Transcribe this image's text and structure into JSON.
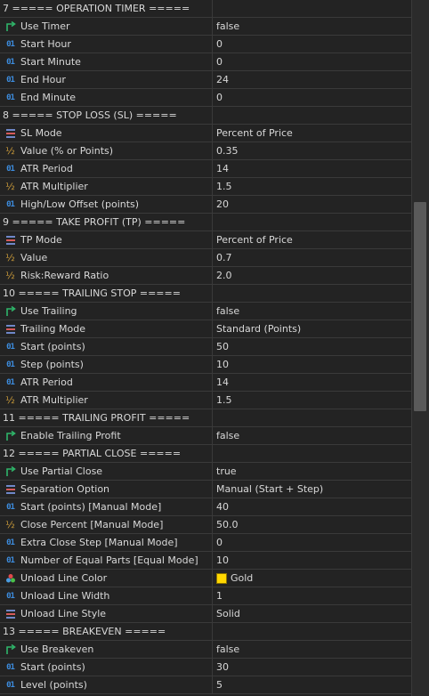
{
  "rows": [
    {
      "kind": "section",
      "name": "7 ===== OPERATION TIMER =====",
      "value": ""
    },
    {
      "kind": "bool",
      "name": "Use Timer",
      "value": "false"
    },
    {
      "kind": "int",
      "name": "Start Hour",
      "value": "0"
    },
    {
      "kind": "int",
      "name": "Start Minute",
      "value": "0"
    },
    {
      "kind": "int",
      "name": "End Hour",
      "value": "24"
    },
    {
      "kind": "int",
      "name": "End Minute",
      "value": "0"
    },
    {
      "kind": "section",
      "name": "8 ===== STOP LOSS (SL) =====",
      "value": ""
    },
    {
      "kind": "enum",
      "name": "SL Mode",
      "value": "Percent of Price"
    },
    {
      "kind": "frac",
      "name": "Value (% or Points)",
      "value": "0.35"
    },
    {
      "kind": "int",
      "name": "ATR Period",
      "value": "14"
    },
    {
      "kind": "frac",
      "name": "ATR Multiplier",
      "value": "1.5"
    },
    {
      "kind": "int",
      "name": "High/Low Offset (points)",
      "value": "20"
    },
    {
      "kind": "section",
      "name": "9 ===== TAKE PROFIT (TP) =====",
      "value": ""
    },
    {
      "kind": "enum",
      "name": "TP Mode",
      "value": "Percent of Price"
    },
    {
      "kind": "frac",
      "name": "Value",
      "value": "0.7"
    },
    {
      "kind": "frac",
      "name": "Risk:Reward Ratio",
      "value": "2.0"
    },
    {
      "kind": "section",
      "name": "10 ===== TRAILING STOP =====",
      "value": ""
    },
    {
      "kind": "bool",
      "name": "Use Trailing",
      "value": "false"
    },
    {
      "kind": "enum",
      "name": "Trailing Mode",
      "value": "Standard (Points)"
    },
    {
      "kind": "int",
      "name": "Start (points)",
      "value": "50"
    },
    {
      "kind": "int",
      "name": "Step (points)",
      "value": "10"
    },
    {
      "kind": "int",
      "name": "ATR Period",
      "value": "14"
    },
    {
      "kind": "frac",
      "name": "ATR Multiplier",
      "value": "1.5"
    },
    {
      "kind": "section",
      "name": "11 ===== TRAILING PROFIT =====",
      "value": ""
    },
    {
      "kind": "bool",
      "name": "Enable Trailing Profit",
      "value": "false"
    },
    {
      "kind": "section",
      "name": "12 ===== PARTIAL CLOSE =====",
      "value": ""
    },
    {
      "kind": "bool",
      "name": "Use Partial Close",
      "value": "true"
    },
    {
      "kind": "enum",
      "name": "Separation Option",
      "value": "Manual (Start + Step)"
    },
    {
      "kind": "int",
      "name": "Start (points) [Manual Mode]",
      "value": "40"
    },
    {
      "kind": "frac",
      "name": "Close Percent [Manual Mode]",
      "value": "50.0"
    },
    {
      "kind": "int",
      "name": "Extra Close Step [Manual Mode]",
      "value": "0"
    },
    {
      "kind": "int",
      "name": "Number of Equal Parts [Equal Mode]",
      "value": "10"
    },
    {
      "kind": "color",
      "name": "Unload Line Color",
      "value": "Gold",
      "swatch": "#ffd700"
    },
    {
      "kind": "int",
      "name": "Unload Line Width",
      "value": "1"
    },
    {
      "kind": "enum",
      "name": "Unload Line Style",
      "value": "Solid"
    },
    {
      "kind": "section",
      "name": "13 ===== BREAKEVEN =====",
      "value": ""
    },
    {
      "kind": "bool",
      "name": "Use Breakeven",
      "value": "false"
    },
    {
      "kind": "int",
      "name": "Start (points)",
      "value": "30"
    },
    {
      "kind": "int",
      "name": "Level (points)",
      "value": "5"
    }
  ],
  "scrollbar": {
    "thumb_start_fraction": 0.29,
    "thumb_visible_fraction": 0.3
  },
  "icon_names": {
    "int": "integer-type-icon",
    "frac": "fraction-type-icon",
    "bool": "boolean-arrow-icon",
    "enum": "enumeration-list-icon",
    "color": "color-palette-icon"
  }
}
